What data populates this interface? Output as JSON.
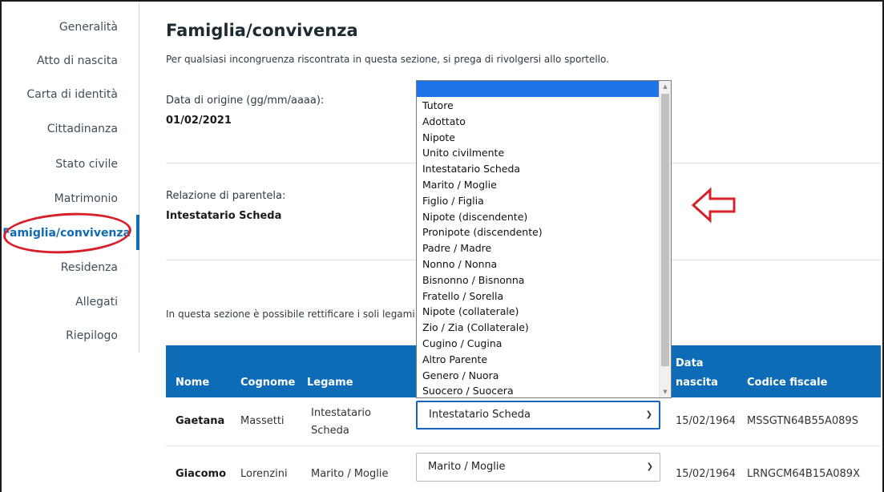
{
  "sidebar": {
    "items": [
      {
        "label": "Generalità"
      },
      {
        "label": "Atto di nascita"
      },
      {
        "label": "Carta di identità"
      },
      {
        "label": "Cittadinanza"
      },
      {
        "label": "Stato civile"
      },
      {
        "label": "Matrimonio"
      },
      {
        "label": "Famiglia/convivenza"
      },
      {
        "label": "Residenza"
      },
      {
        "label": "Allegati"
      },
      {
        "label": "Riepilogo"
      }
    ],
    "active_index": 6
  },
  "main": {
    "title": "Famiglia/convivenza",
    "subtitle": "Per qualsiasi incongruenza riscontrata in questa sezione, si prega di rivolgersi allo sportello.",
    "origin_date_label": "Data di origine (gg/mm/aaaa):",
    "origin_date_value": "01/02/2021",
    "relation_label": "Relazione di parentela:",
    "relation_value": "Intestatario Scheda",
    "note": "In questa sezione è possibile rettificare i soli legami"
  },
  "table": {
    "headers": {
      "nome": "Nome",
      "cognome": "Cognome",
      "legame": "Legame",
      "data_nascita_1": "Data",
      "data_nascita_2": "nascita",
      "codice_fiscale": "Codice fiscale"
    },
    "rows": [
      {
        "nome": "Gaetana",
        "cognome": "Massetti",
        "legame_1": "Intestatario",
        "legame_2": "Scheda",
        "select_value": "Intestatario Scheda",
        "data_nascita": "15/02/1964",
        "codice_fiscale": "MSSGTN64B55A089S"
      },
      {
        "nome": "Giacomo",
        "cognome": "Lorenzini",
        "legame_1": "Marito / Moglie",
        "legame_2": "",
        "select_value": "Marito / Moglie",
        "data_nascita": "15/02/1964",
        "codice_fiscale": "LRNGCM64B15A089X"
      }
    ]
  },
  "dropdown": {
    "options": [
      "Tutore",
      "Adottato",
      "Nipote",
      "Unito civilmente",
      "Intestatario Scheda",
      "Marito / Moglie",
      "Figlio / Figlia",
      "Nipote (discendente)",
      "Pronipote (discendente)",
      "Padre / Madre",
      "Nonno / Nonna",
      "Bisnonno / Bisnonna",
      "Fratello / Sorella",
      "Nipote (collaterale)",
      "Zio / Zia (Collaterale)",
      "Cugino / Cugina",
      "Altro Parente",
      "Genero / Nuora",
      "Suocero / Suocera"
    ]
  },
  "colors": {
    "accent": "#0e6bb5",
    "annotation": "#d9202a",
    "dropdown_highlight": "#1e73e6"
  }
}
